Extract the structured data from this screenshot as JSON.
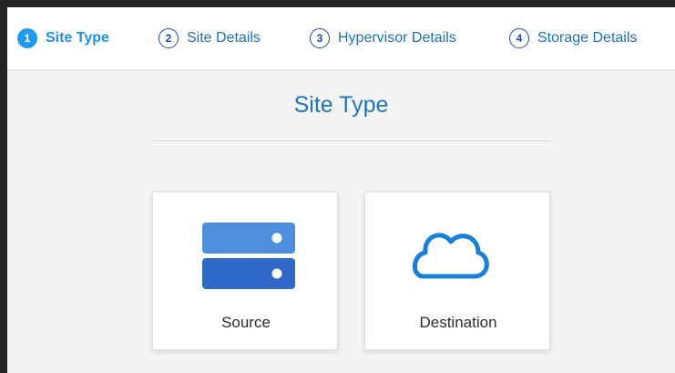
{
  "steps": [
    {
      "number": "1",
      "label": "Site Type",
      "active": true
    },
    {
      "number": "2",
      "label": "Site Details",
      "active": false
    },
    {
      "number": "3",
      "label": "Hypervisor Details",
      "active": false
    },
    {
      "number": "4",
      "label": "Storage Details",
      "active": false
    }
  ],
  "page": {
    "title": "Site Type"
  },
  "options": [
    {
      "label": "Source",
      "icon": "server-icon"
    },
    {
      "label": "Destination",
      "icon": "cloud-icon"
    }
  ],
  "colors": {
    "accent": "#1e9bef",
    "title": "#1f74c0",
    "step_text": "#1f6fb8",
    "server_top": "#4d8fdd",
    "server_bottom": "#2f68c6",
    "cloud": "#1a7fd6"
  }
}
